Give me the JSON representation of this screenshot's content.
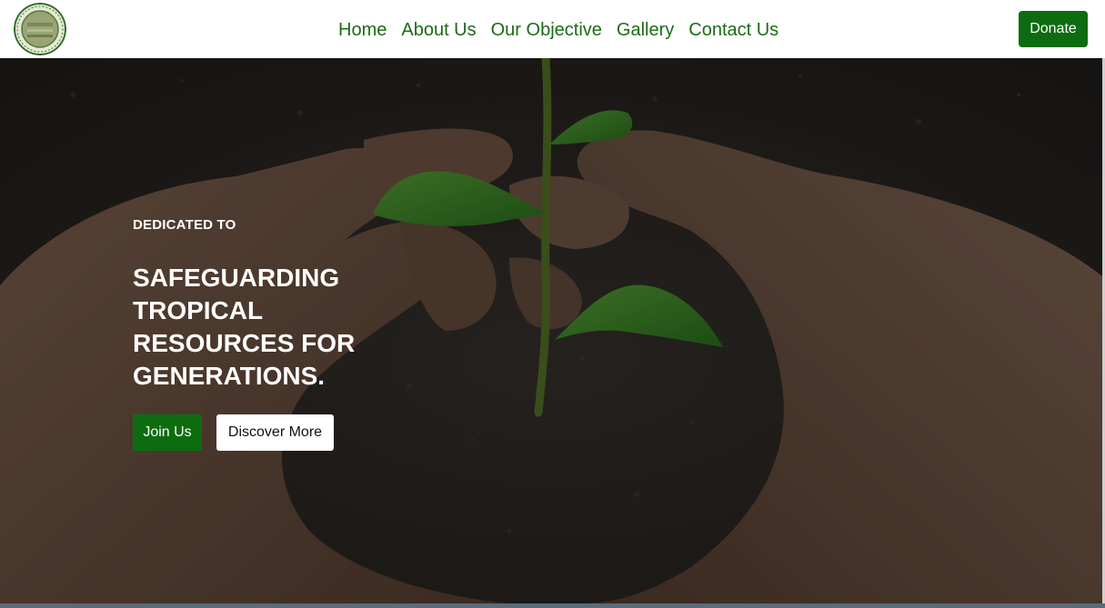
{
  "header": {
    "logo_icon": "organization-seal-logo",
    "nav": [
      {
        "label": "Home"
      },
      {
        "label": "About Us"
      },
      {
        "label": "Our Objective"
      },
      {
        "label": "Gallery"
      },
      {
        "label": "Contact Us"
      }
    ],
    "donate_label": "Donate"
  },
  "hero": {
    "background_icon": "hands-cupping-seedling-image",
    "eyebrow": "DEDICATED TO",
    "headline": "SAFEGUARDING TROPICAL RESOURCES FOR GENERATIONS.",
    "join_label": "Join Us",
    "discover_label": "Discover More"
  },
  "colors": {
    "brand_green": "#1c6b16",
    "button_green": "#0d6c10",
    "white": "#ffffff"
  }
}
